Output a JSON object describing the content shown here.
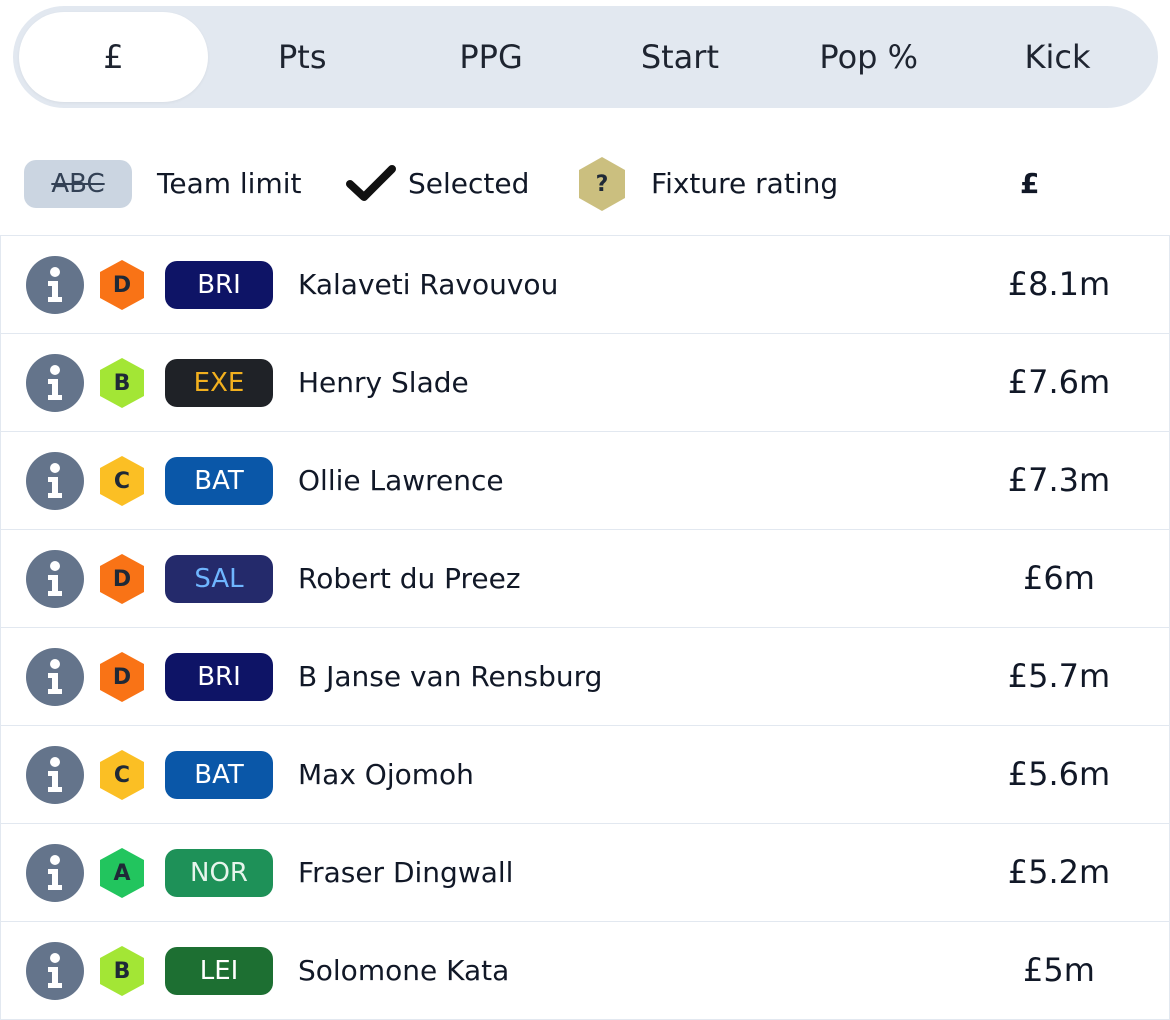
{
  "tabs": [
    {
      "label": "£",
      "active": true
    },
    {
      "label": "Pts",
      "active": false
    },
    {
      "label": "PPG",
      "active": false
    },
    {
      "label": "Start",
      "active": false
    },
    {
      "label": "Pop %",
      "active": false
    },
    {
      "label": "Kick",
      "active": false
    }
  ],
  "legend": {
    "team_limit_badge": "ABC",
    "team_limit_label": "Team limit",
    "selected_label": "Selected",
    "fixture_rating_symbol": "?",
    "fixture_rating_label": "Fixture rating",
    "column_header": "£"
  },
  "colors": {
    "rating": {
      "A": "#22c55e",
      "B": "#a3e635",
      "C": "#fbbf24",
      "D": "#f97316",
      "unknown": "#cbbf7f"
    },
    "teams": {
      "BRI": {
        "bg": "#0e1466",
        "fg": "#ffffff"
      },
      "EXE": {
        "bg": "#1f2227",
        "fg": "#f2b01e"
      },
      "BAT": {
        "bg": "#0a57a8",
        "fg": "#ffffff"
      },
      "SAL": {
        "bg": "#242a6b",
        "fg": "#6fb6ff"
      },
      "NOR": {
        "bg": "#1e9158",
        "fg": "#e6f5ec"
      },
      "LEI": {
        "bg": "#1d6f32",
        "fg": "#ffffff"
      }
    }
  },
  "players": [
    {
      "rating": "D",
      "team": "BRI",
      "name": "Kalaveti Ravouvou",
      "price": "£8.1m"
    },
    {
      "rating": "B",
      "team": "EXE",
      "name": "Henry Slade",
      "price": "£7.6m"
    },
    {
      "rating": "C",
      "team": "BAT",
      "name": "Ollie Lawrence",
      "price": "£7.3m"
    },
    {
      "rating": "D",
      "team": "SAL",
      "name": "Robert du Preez",
      "price": "£6m"
    },
    {
      "rating": "D",
      "team": "BRI",
      "name": "B Janse van Rensburg",
      "price": "£5.7m"
    },
    {
      "rating": "C",
      "team": "BAT",
      "name": "Max Ojomoh",
      "price": "£5.6m"
    },
    {
      "rating": "A",
      "team": "NOR",
      "name": "Fraser Dingwall",
      "price": "£5.2m"
    },
    {
      "rating": "B",
      "team": "LEI",
      "name": "Solomone Kata",
      "price": "£5m"
    }
  ]
}
